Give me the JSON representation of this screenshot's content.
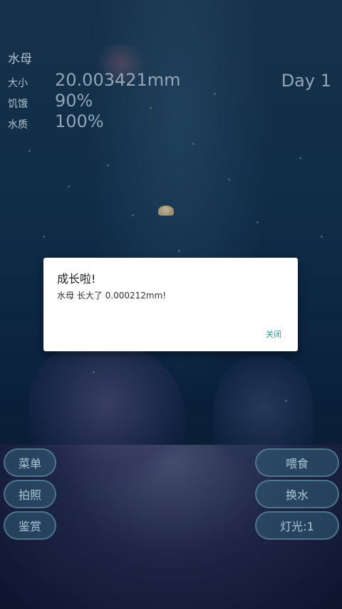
{
  "hud": {
    "creature_name": "水母",
    "stats": [
      {
        "label": "大小",
        "value": "20.003421mm"
      },
      {
        "label": "饥饿",
        "value": "90%"
      },
      {
        "label": "水质",
        "value": "100%"
      }
    ],
    "day": "Day 1"
  },
  "left_buttons": [
    {
      "label": "菜单"
    },
    {
      "label": "拍照"
    },
    {
      "label": "鉴赏"
    }
  ],
  "right_buttons": [
    {
      "label": "喂食"
    },
    {
      "label": "换水"
    },
    {
      "label": "灯光:1"
    }
  ],
  "dialog": {
    "title": "成长啦!",
    "message": "水母 长大了 0.000212mm!",
    "close_label": "关闭"
  },
  "colors": {
    "accent": "#2a9c8c",
    "button_bg": "#325f78",
    "water": "#153a5c"
  }
}
